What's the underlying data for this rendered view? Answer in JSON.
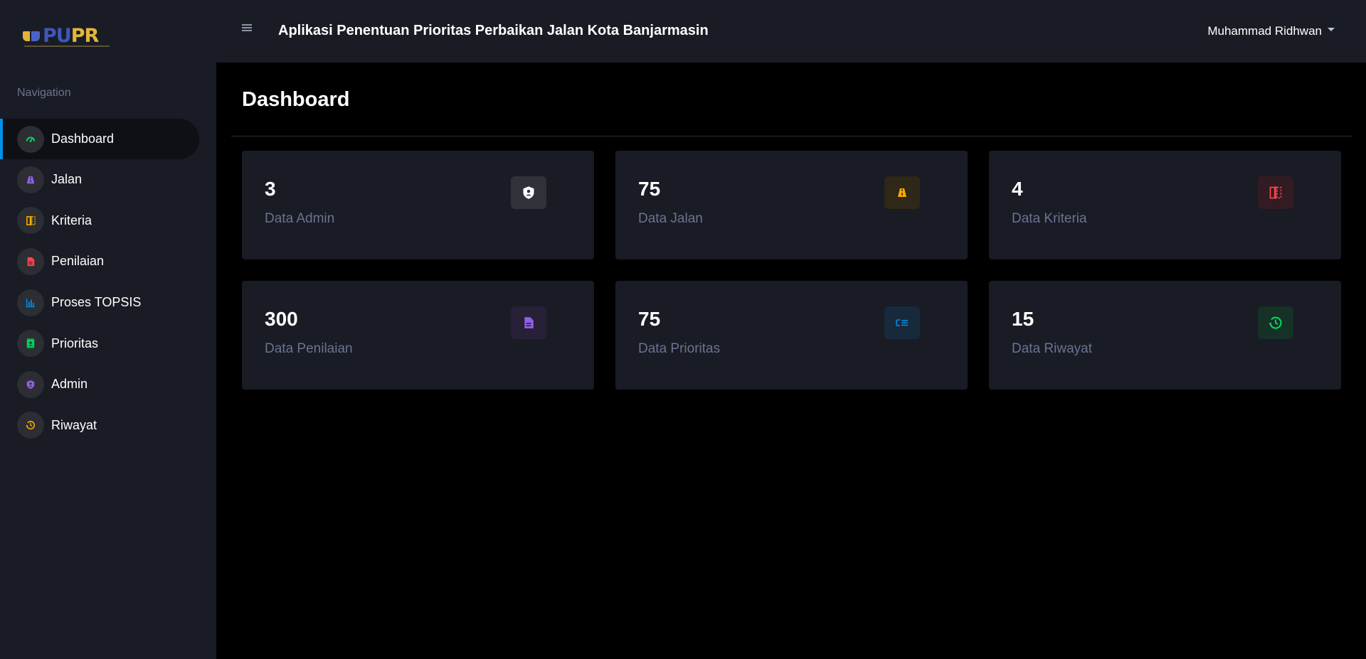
{
  "app": {
    "title": "Aplikasi Penentuan Prioritas Perbaikan Jalan Kota Banjarmasin",
    "logo_text_blue": "PU",
    "logo_text_gold": "PR"
  },
  "header": {
    "user_name": "Muhammad Ridhwan"
  },
  "sidebar": {
    "caption": "Navigation",
    "items": [
      {
        "label": "Dashboard",
        "icon": "speedometer-icon",
        "color": "#00d25b",
        "active": true
      },
      {
        "label": "Jalan",
        "icon": "road-icon",
        "color": "#8f5fe8"
      },
      {
        "label": "Kriteria",
        "icon": "compare-icon",
        "color": "#ffab00"
      },
      {
        "label": "Penilaian",
        "icon": "file-document-icon",
        "color": "#fc424a"
      },
      {
        "label": "Proses TOPSIS",
        "icon": "chart-bar-icon",
        "color": "#0090e7"
      },
      {
        "label": "Prioritas",
        "icon": "contacts-icon",
        "color": "#00d25b"
      },
      {
        "label": "Admin",
        "icon": "account-shield-icon",
        "color": "#8f5fe8"
      },
      {
        "label": "Riwayat",
        "icon": "history-icon",
        "color": "#ffab00"
      }
    ]
  },
  "main": {
    "page_title": "Dashboard",
    "cards": [
      {
        "value": "3",
        "label": "Data Admin",
        "icon": "account-shield-icon",
        "color": "#ffffff",
        "bg": "#2f3238"
      },
      {
        "value": "75",
        "label": "Data Jalan",
        "icon": "road-icon",
        "color": "#ffab00",
        "bg": "#2f2718"
      },
      {
        "value": "4",
        "label": "Data Kriteria",
        "icon": "compare-icon",
        "color": "#fc424a",
        "bg": "#321b22"
      },
      {
        "value": "300",
        "label": "Data Penilaian",
        "icon": "file-document-icon",
        "color": "#8f5fe8",
        "bg": "#272036"
      },
      {
        "value": "75",
        "label": "Data Prioritas",
        "icon": "format-list-icon",
        "color": "#0090e7",
        "bg": "#162a3c"
      },
      {
        "value": "15",
        "label": "Data Riwayat",
        "icon": "history-icon",
        "color": "#00d25b",
        "bg": "#163126"
      }
    ]
  }
}
